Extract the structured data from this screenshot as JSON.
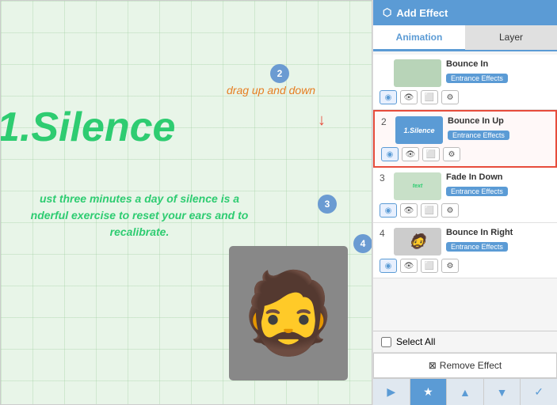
{
  "panel": {
    "header": {
      "add_effect_label": "Add Effect",
      "add_icon": "+"
    },
    "tabs": [
      {
        "id": "animation",
        "label": "Animation",
        "active": true
      },
      {
        "id": "layer",
        "label": "Layer",
        "active": false
      }
    ],
    "animations": [
      {
        "id": 1,
        "num": "",
        "thumb_type": "green",
        "thumb_text": "",
        "name": "Bounce In",
        "badge": "Entrance Effects",
        "selected": false,
        "controls": [
          "eye-circle",
          "eye",
          "screen",
          "gear"
        ]
      },
      {
        "id": 2,
        "num": "2",
        "thumb_type": "blue",
        "thumb_text": "1.Silence",
        "name": "Bounce In Up",
        "badge": "Entrance Effects",
        "selected": true,
        "controls": [
          "eye-circle",
          "eye",
          "screen",
          "gear"
        ]
      },
      {
        "id": 3,
        "num": "3",
        "thumb_type": "green-text",
        "thumb_text": "text block",
        "name": "Fade In Down",
        "badge": "Entrance Effects",
        "selected": false,
        "controls": [
          "eye-circle",
          "eye",
          "screen",
          "gear"
        ]
      },
      {
        "id": 4,
        "num": "4",
        "thumb_type": "character",
        "thumb_text": "char",
        "name": "Bounce In Right",
        "badge": "Entrance Effects",
        "selected": false,
        "controls": [
          "eye-circle",
          "eye",
          "screen",
          "gear"
        ]
      }
    ],
    "bottom": {
      "select_all_label": "Select All",
      "remove_effect_label": "Remove Effect"
    },
    "toolbar": [
      "play",
      "star",
      "up",
      "down",
      "check"
    ]
  },
  "canvas": {
    "badge_2": "2",
    "badge_3": "3",
    "badge_4": "4",
    "drag_text": "drag up and down",
    "title": "1.Silence",
    "body_text": "ust three minutes a day of silence is a\nnderful exercise to reset your ears and to\nrecalibrate."
  }
}
